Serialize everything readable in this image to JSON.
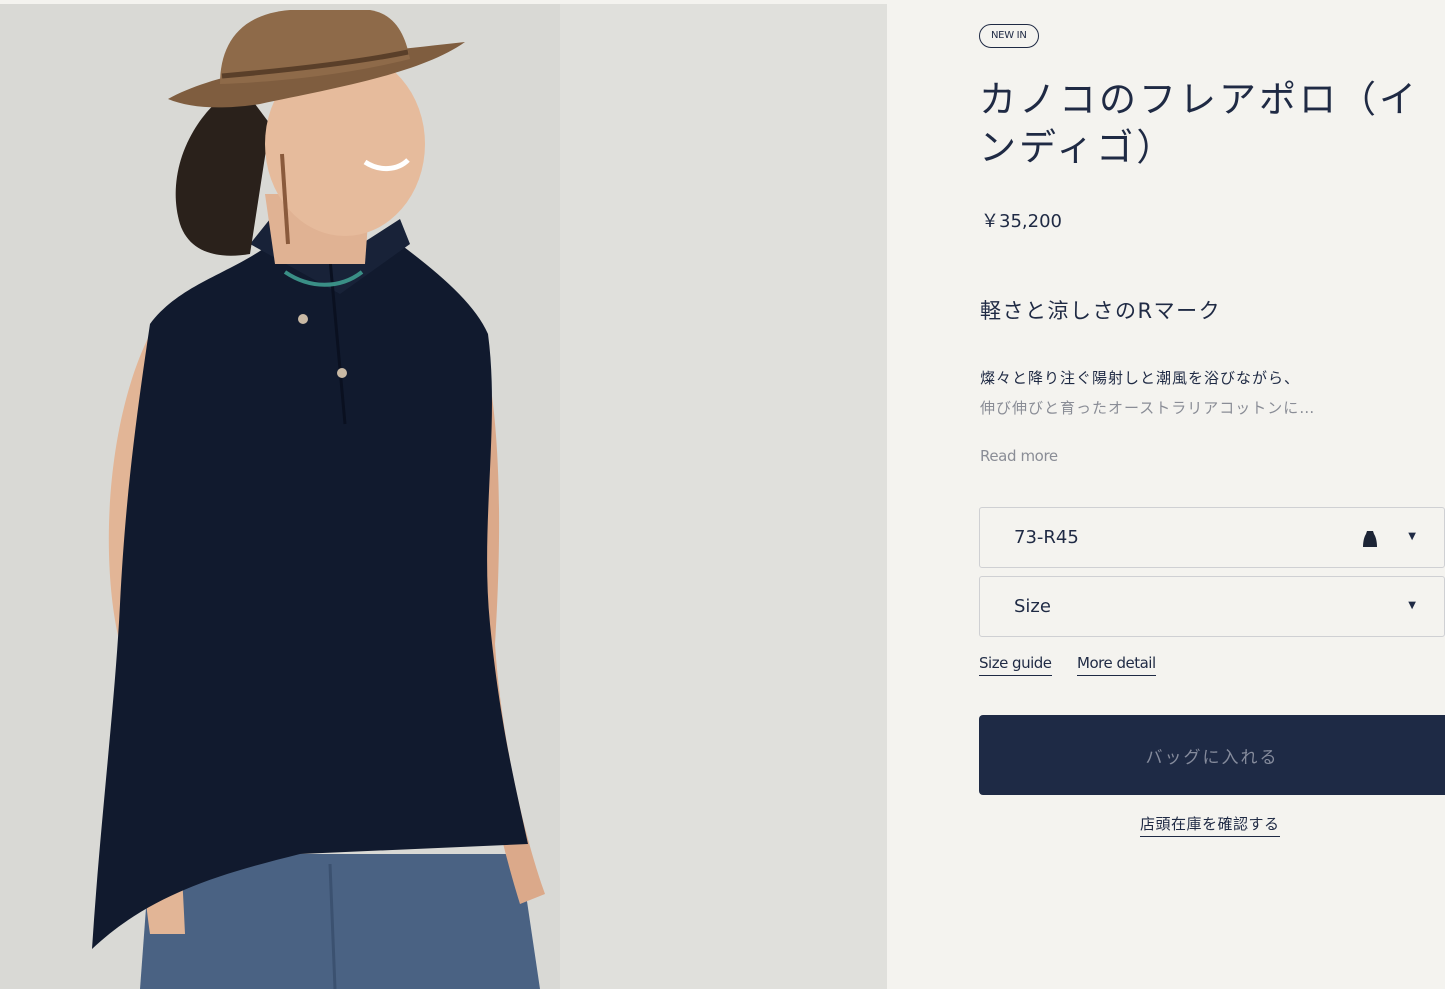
{
  "badge": "NEW IN",
  "product": {
    "title": "カノコのフレアポロ（インディゴ）",
    "price": "￥35,200"
  },
  "description": {
    "heading": "軽さと涼しさのRマーク",
    "line1": "燦々と降り注ぐ陽射しと潮風を浴びながら、",
    "line2": "伸び伸びと育ったオーストラリアコットンに…",
    "read_more": "Read more"
  },
  "selectors": {
    "color": {
      "value": "73-R45",
      "swatch_icon": "garment-swatch-icon"
    },
    "size": {
      "value": "Size"
    },
    "chevron_icon": "chevron-down-icon"
  },
  "links": {
    "size_guide": "Size guide",
    "more_detail": "More detail",
    "store_stock": "店頭在庫を確認する"
  },
  "cta": {
    "add_to_bag": "バッグに入れる"
  },
  "colors": {
    "brand_navy": "#1e2a45",
    "background": "#f4f3ef",
    "muted_text": "#8a8d96"
  }
}
